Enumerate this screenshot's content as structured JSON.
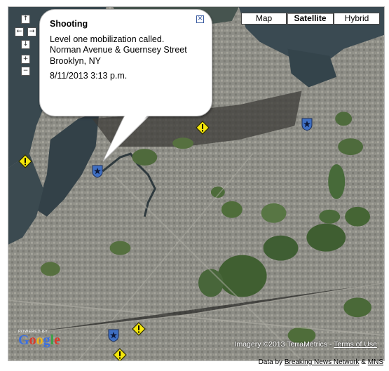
{
  "map": {
    "type_buttons": [
      {
        "label": "Map",
        "active": false
      },
      {
        "label": "Satellite",
        "active": true
      },
      {
        "label": "Hybrid",
        "active": false
      }
    ],
    "nav_controls": {
      "pan_up": "↑",
      "pan_left": "←",
      "pan_right": "→",
      "pan_down": "↓",
      "zoom_in": "+",
      "zoom_out": "−"
    },
    "imagery_text": "Imagery ©2013 TerraMetrics",
    "separator": " - ",
    "terms_link": "Terms of Use",
    "powered_by": "POWERED BY",
    "logo_text": "Google"
  },
  "info_window": {
    "title": "Shooting",
    "line1": "Level one mobilization called.",
    "line2": "Norman Avenue & Guernsey Street",
    "line3": "Brooklyn, NY",
    "timestamp": "8/11/2013 3:13 p.m.",
    "close_symbol": "✕"
  },
  "markers": {
    "police_icon": "shield-star-icon",
    "warning_icon": "warning-diamond-icon",
    "police_color": "#3f6fc2",
    "warning_color": "#f4e60b"
  },
  "attribution": {
    "prefix": "Data by ",
    "source1": "Breaking News Network",
    "amp": " & ",
    "source2": "MNS"
  }
}
